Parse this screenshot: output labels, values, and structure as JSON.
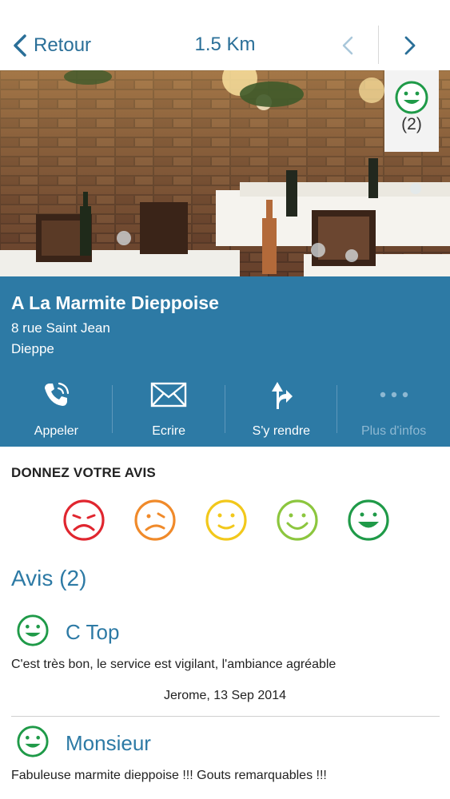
{
  "topbar": {
    "back_label": "Retour",
    "distance": "1.5 Km",
    "prev_icon": "chevron-left-icon",
    "next_icon": "chevron-right-icon"
  },
  "photo": {
    "rating_count": "(2)",
    "rating_icon": "smile-face-icon"
  },
  "restaurant": {
    "name": "A La Marmite Dieppoise",
    "address_line1": "8 rue Saint Jean",
    "address_line2": "Dieppe"
  },
  "actions": [
    {
      "label": "Appeler",
      "icon": "phone-icon"
    },
    {
      "label": "Ecrire",
      "icon": "envelope-icon"
    },
    {
      "label": "S'y rendre",
      "icon": "directions-icon"
    },
    {
      "label": "Plus d'infos",
      "icon": "more-dots-icon"
    }
  ],
  "feedback": {
    "title": "DONNEZ VOTRE AVIS",
    "faces": [
      {
        "icon": "very-sad-face-icon",
        "color": "#e0262f"
      },
      {
        "icon": "sad-face-icon",
        "color": "#f08a2a"
      },
      {
        "icon": "neutral-face-icon",
        "color": "#f2c81b"
      },
      {
        "icon": "happy-face-icon",
        "color": "#8cc63e"
      },
      {
        "icon": "very-happy-face-icon",
        "color": "#1f9a48"
      }
    ]
  },
  "reviews": {
    "title": "Avis (2)",
    "items": [
      {
        "title": "C Top",
        "text": "C'est très bon, le service est vigilant, l'ambiance agréable",
        "meta": "Jerome, 13 Sep 2014"
      },
      {
        "title": "Monsieur",
        "text": "Fabuleuse marmite dieppoise !!! Gouts remarquables !!!",
        "meta": ""
      }
    ]
  },
  "colors": {
    "brand_blue": "#2d7aa5",
    "face_green": "#1f9a48"
  }
}
